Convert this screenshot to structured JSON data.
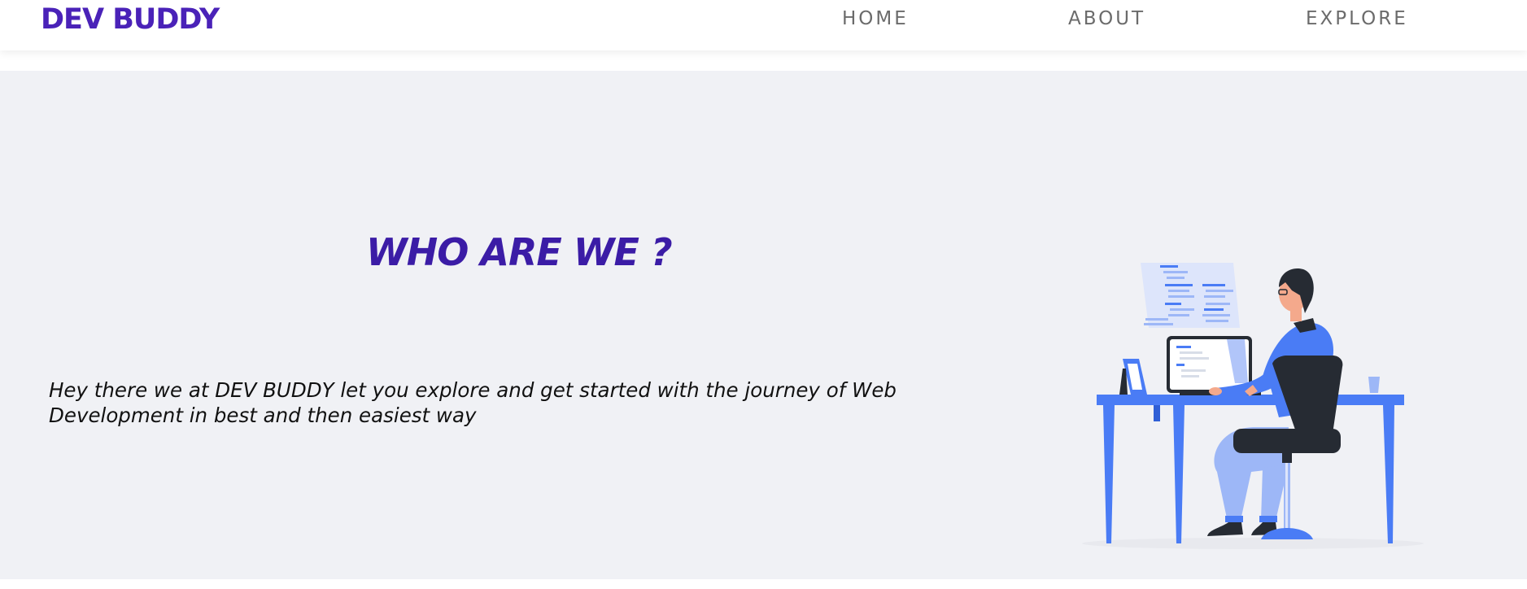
{
  "navbar": {
    "logo": "DEV BUDDY",
    "links": [
      {
        "label": "HOME"
      },
      {
        "label": "ABOUT"
      },
      {
        "label": "EXPLORE"
      }
    ]
  },
  "hero": {
    "title": "WHO ARE WE ?",
    "description": "Hey there we at DEV BUDDY let you explore and get started with the journey of Web Development in best and then easiest way",
    "illustration_icon": "developer-at-desk-illustration"
  },
  "colors": {
    "brand": "#4a22b8",
    "title": "#3b1ca6",
    "hero_background": "#f0f1f5",
    "nav_text": "#6b6b6b",
    "illustration_blue": "#4a7cf5"
  }
}
